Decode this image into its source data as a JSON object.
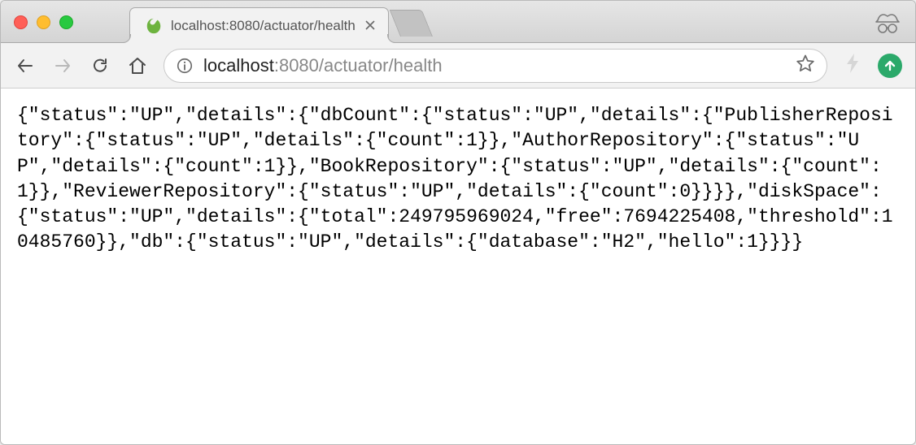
{
  "tab": {
    "title": "localhost:8080/actuator/health"
  },
  "address": {
    "host": "localhost",
    "port_path": ":8080/actuator/health"
  },
  "body_text": "{\"status\":\"UP\",\"details\":{\"dbCount\":{\"status\":\"UP\",\"details\":{\"PublisherRepository\":{\"status\":\"UP\",\"details\":{\"count\":1}},\"AuthorRepository\":{\"status\":\"UP\",\"details\":{\"count\":1}},\"BookRepository\":{\"status\":\"UP\",\"details\":{\"count\":1}},\"ReviewerRepository\":{\"status\":\"UP\",\"details\":{\"count\":0}}}},\"diskSpace\":{\"status\":\"UP\",\"details\":{\"total\":249795969024,\"free\":7694225408,\"threshold\":10485760}},\"db\":{\"status\":\"UP\",\"details\":{\"database\":\"H2\",\"hello\":1}}}}"
}
